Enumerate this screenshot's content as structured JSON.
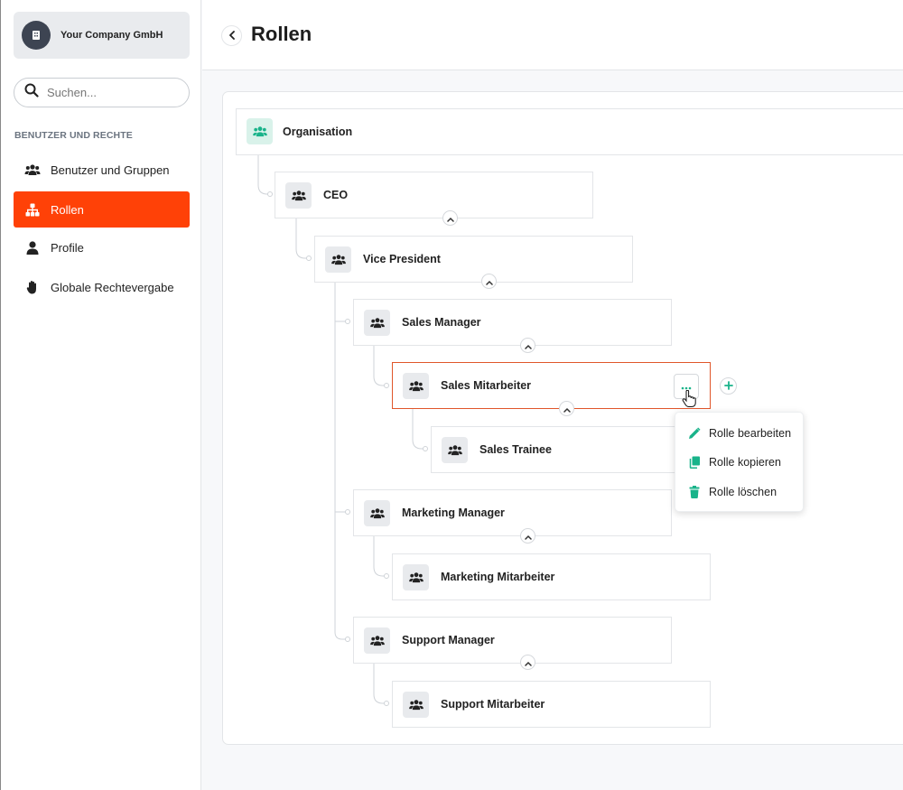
{
  "sidebar": {
    "company": "Your Company GmbH",
    "search_placeholder": "Suchen...",
    "section_title": "BENUTZER UND RECHTE",
    "items": [
      {
        "label": "Benutzer und Gruppen",
        "icon": "users-icon"
      },
      {
        "label": "Rollen",
        "icon": "hierarchy-icon",
        "active": true
      },
      {
        "label": "Profile",
        "icon": "person-icon"
      },
      {
        "label": "Globale Rechtevergabe",
        "icon": "hand-icon"
      }
    ]
  },
  "header": {
    "title": "Rollen"
  },
  "tree": {
    "root": "Organisation",
    "nodes": [
      {
        "label": "CEO"
      },
      {
        "label": "Vice President"
      },
      {
        "label": "Sales Manager"
      },
      {
        "label": "Sales Mitarbeiter",
        "selected": true
      },
      {
        "label": "Sales Trainee"
      },
      {
        "label": "Marketing Manager"
      },
      {
        "label": "Marketing Mitarbeiter"
      },
      {
        "label": "Support Manager"
      },
      {
        "label": "Support Mitarbeiter"
      }
    ]
  },
  "context_menu": {
    "items": [
      {
        "label": "Rolle bearbeiten",
        "icon": "pencil-icon"
      },
      {
        "label": "Rolle kopieren",
        "icon": "copy-icon"
      },
      {
        "label": "Rolle löschen",
        "icon": "trash-icon"
      }
    ]
  },
  "colors": {
    "accent": "#ff4107",
    "green": "#19b38a",
    "selected_border": "#e0562a"
  }
}
